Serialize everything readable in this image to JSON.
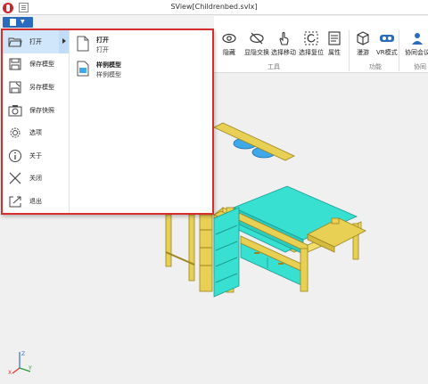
{
  "window": {
    "title": "SView[Childrenbed.svlx]"
  },
  "ribbon": {
    "tools_group": {
      "label": "工具",
      "buttons": [
        {
          "label": "隐藏",
          "icon": "eye-icon"
        },
        {
          "label": "显隐交换",
          "icon": "eye-slash-icon"
        },
        {
          "label": "选择移动",
          "icon": "hand-pointer-icon"
        },
        {
          "label": "选择复位",
          "icon": "select-reset-icon"
        },
        {
          "label": "属性",
          "icon": "properties-icon"
        }
      ]
    },
    "function_group": {
      "label": "功能",
      "buttons": [
        {
          "label": "漫游",
          "icon": "roam-cube-icon"
        },
        {
          "label": "VR模式",
          "icon": "vr-headset-icon"
        }
      ]
    },
    "collab_group": {
      "label": "协同",
      "buttons": [
        {
          "label": "协同会议",
          "icon": "collab-users-icon"
        }
      ]
    }
  },
  "file_menu": {
    "items": [
      {
        "label": "打开",
        "icon": "open-folder-icon",
        "active": true
      },
      {
        "label": "保存模型",
        "icon": "save-model-icon"
      },
      {
        "label": "另存模型",
        "icon": "save-as-icon"
      },
      {
        "label": "保存快照",
        "icon": "camera-icon"
      },
      {
        "label": "选项",
        "icon": "gear-icon"
      },
      {
        "label": "关于",
        "icon": "info-icon"
      },
      {
        "label": "关闭",
        "icon": "close-icon"
      },
      {
        "label": "退出",
        "icon": "exit-icon"
      }
    ],
    "submenu": [
      {
        "title": "打开",
        "desc": "打开",
        "icon": "document-icon"
      },
      {
        "title": "样例模型",
        "desc": "样例模型",
        "icon": "sample-model-icon"
      }
    ]
  },
  "viewport": {
    "axis_labels": {
      "x": "X",
      "y": "Y",
      "z": "Z"
    },
    "colors": {
      "frame": "#e8d054",
      "frame_dark": "#b89f25",
      "mattress": "#37e0d0",
      "background": "#f0f0f0"
    }
  }
}
